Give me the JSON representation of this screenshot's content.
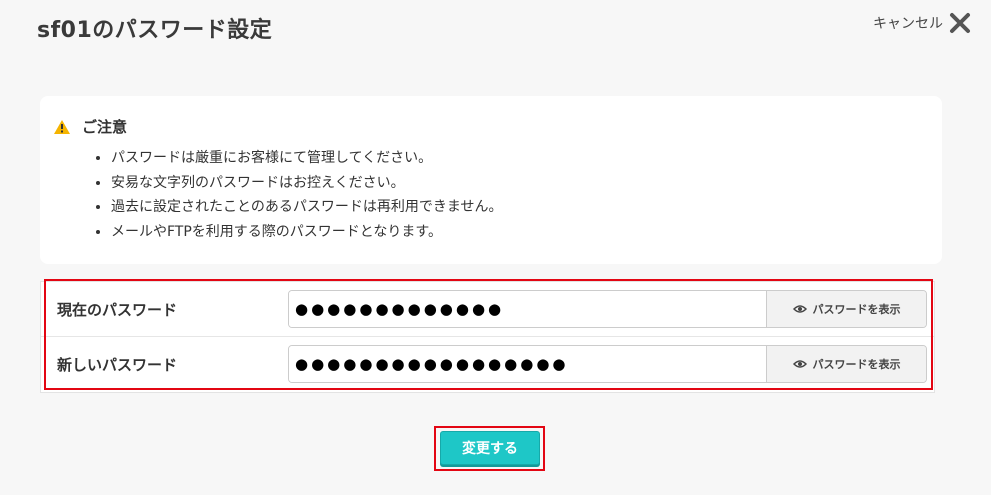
{
  "dialog": {
    "title": "sf01のパスワード設定",
    "cancel_label": "キャンセル"
  },
  "notice": {
    "heading": "ご注意",
    "items": [
      "パスワードは厳重にお客様にて管理してください。",
      "安易な文字列のパスワードはお控えください。",
      "過去に設定されたことのあるパスワードは再利用できません。",
      "メールやFTPを利用する際のパスワードとなります。"
    ]
  },
  "form": {
    "current_password": {
      "label": "現在のパスワード",
      "value": "●●●●●●●●●●●●●",
      "show_label": "パスワードを表示"
    },
    "new_password": {
      "label": "新しいパスワード",
      "value": "●●●●●●●●●●●●●●●●●",
      "show_label": "パスワードを表示"
    }
  },
  "submit_label": "変更する",
  "colors": {
    "accent": "#1ec7c7",
    "highlight": "#e30613",
    "warning": "#f5b400"
  }
}
